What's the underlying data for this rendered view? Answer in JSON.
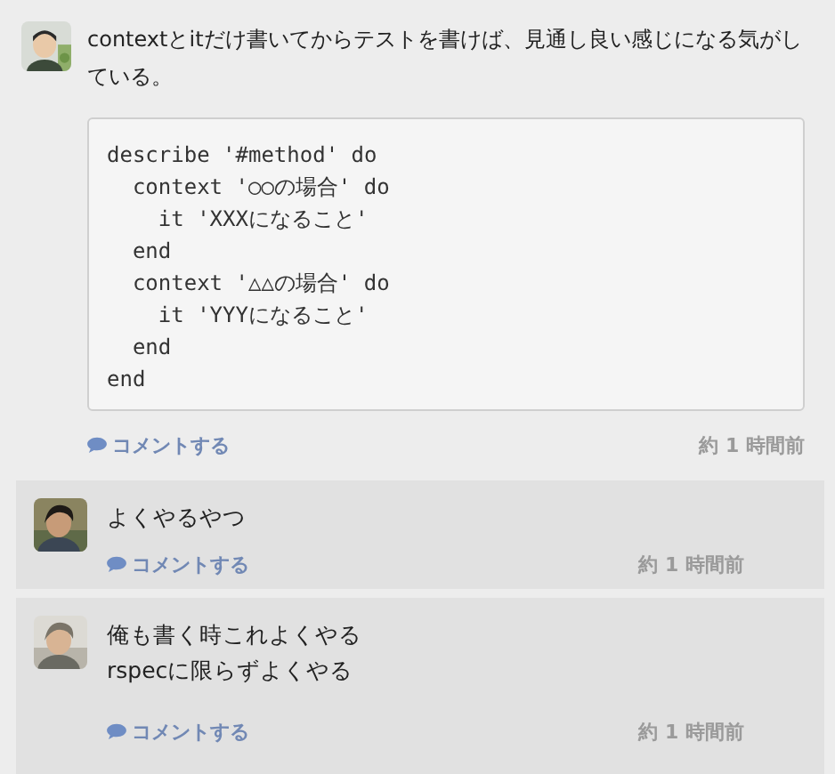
{
  "post": {
    "text": "contextとitだけ書いてからテストを書けば、見通し良い感じになる気がしている。",
    "code": "describe '#method' do\n  context '○○の場合' do\n    it 'XXXになること'\n  end\n  context '△△の場合' do\n    it 'YYYになること'\n  end\nend",
    "comment_link": "コメントする",
    "time": "約 1 時間前"
  },
  "replies": [
    {
      "lines": [
        "よくやるやつ"
      ],
      "comment_link": "コメントする",
      "time": "約 1 時間前"
    },
    {
      "lines": [
        "俺も書く時これよくやる",
        "rspecに限らずよくやる"
      ],
      "comment_link": "コメントする",
      "time": "約 1 時間前"
    }
  ]
}
